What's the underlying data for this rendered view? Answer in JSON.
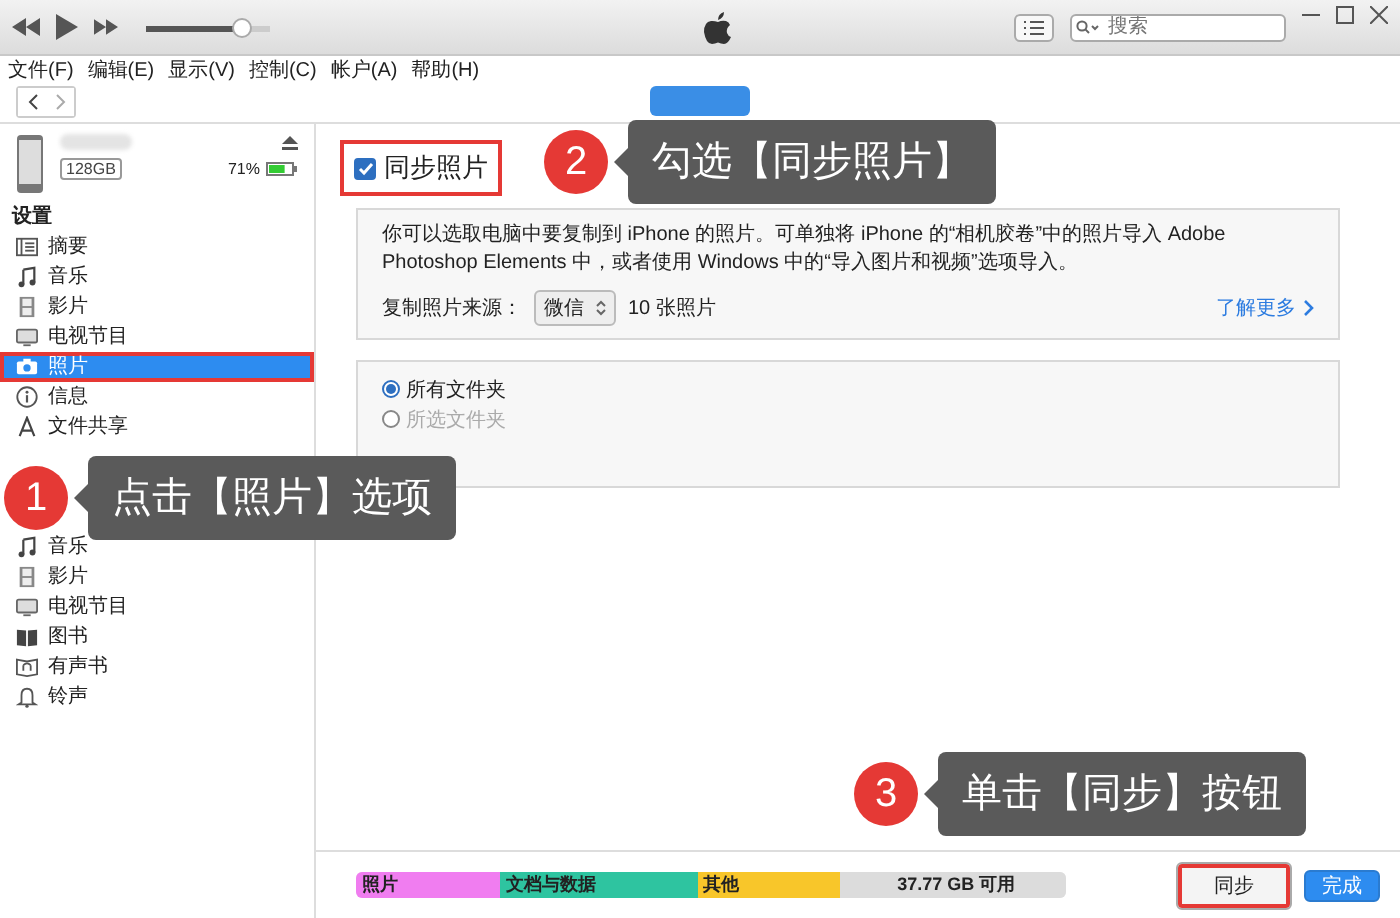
{
  "player": {
    "volume": {
      "level": 0.82
    }
  },
  "search": {
    "placeholder": "搜索"
  },
  "menu": [
    "文件(F)",
    "编辑(E)",
    "显示(V)",
    "控制(C)",
    "帐户(A)",
    "帮助(H)"
  ],
  "device": {
    "capacity": "128GB",
    "battery": {
      "text": "71%",
      "level": 0.71
    }
  },
  "sidebar": {
    "sections": [
      {
        "title": "设置",
        "items": [
          {
            "label": "摘要",
            "kind": "summary",
            "selected": false,
            "highlighted": false
          },
          {
            "label": "音乐",
            "kind": "music",
            "selected": false,
            "highlighted": false
          },
          {
            "label": "影片",
            "kind": "movies",
            "selected": false,
            "highlighted": false
          },
          {
            "label": "电视节目",
            "kind": "tv",
            "selected": false,
            "highlighted": false
          },
          {
            "label": "照片",
            "kind": "photos",
            "selected": true,
            "highlighted": true
          },
          {
            "label": "信息",
            "kind": "info",
            "selected": false,
            "highlighted": false
          },
          {
            "label": "文件共享",
            "kind": "files",
            "selected": false,
            "highlighted": false
          }
        ]
      },
      {
        "items": [
          {
            "label": "音乐",
            "kind": "music",
            "selected": false,
            "highlighted": false
          },
          {
            "label": "影片",
            "kind": "movies",
            "selected": false,
            "highlighted": false
          },
          {
            "label": "电视节目",
            "kind": "tv",
            "selected": false,
            "highlighted": false
          },
          {
            "label": "图书",
            "kind": "books",
            "selected": false,
            "highlighted": false
          },
          {
            "label": "有声书",
            "kind": "audiobooks",
            "selected": false,
            "highlighted": false
          },
          {
            "label": "铃声",
            "kind": "tones",
            "selected": false,
            "highlighted": false
          }
        ]
      }
    ]
  },
  "sync": {
    "label": "同步照片",
    "checked": true,
    "highlighted": true
  },
  "info": {
    "description": "你可以选取电脑中要复制到 iPhone 的照片。可单独将 iPhone 的“相机胶卷”中的照片导入 Adobe Photoshop Elements 中，或者使用 Windows 中的“导入图片和视频”选项导入。",
    "source_label": "复制照片来源：",
    "source_value": "微信",
    "photo_count": "10 张照片",
    "learn_more": "了解更多"
  },
  "folders": [
    {
      "label": "所有文件夹",
      "selected": true,
      "disabled": false
    },
    {
      "label": "所选文件夹",
      "selected": false,
      "disabled": true
    }
  ],
  "storage": [
    {
      "label": "照片",
      "color": "#f07df0"
    },
    {
      "label": "文档与数据",
      "color": "#2ec4a0"
    },
    {
      "label": "其他",
      "color": "#f8c62a"
    },
    {
      "label": "37.77 GB 可用",
      "color": "#dcdcdc"
    }
  ],
  "buttons": [
    {
      "label": "同步",
      "kind": "plain",
      "highlighted": true
    },
    {
      "label": "完成",
      "kind": "primary",
      "highlighted": false
    }
  ],
  "callouts": [
    {
      "number": "1",
      "text": "点击【照片】选项"
    },
    {
      "number": "2",
      "text": "勾选【同步照片】"
    },
    {
      "number": "3",
      "text": "单击【同步】按钮"
    }
  ]
}
